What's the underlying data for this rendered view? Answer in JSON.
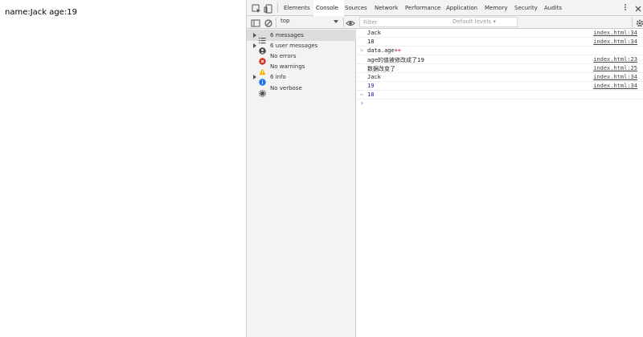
{
  "page": {
    "text": "name:Jack age:19"
  },
  "devtools": {
    "tabs": [
      {
        "label": "Elements",
        "active": false
      },
      {
        "label": "Console",
        "active": true
      },
      {
        "label": "Sources",
        "active": false
      },
      {
        "label": "Network",
        "active": false
      },
      {
        "label": "Performance",
        "active": false
      },
      {
        "label": "Application",
        "active": false
      },
      {
        "label": "Memory",
        "active": false
      },
      {
        "label": "Security",
        "active": false
      },
      {
        "label": "Audits",
        "active": false
      }
    ],
    "toolbar": {
      "context": "top",
      "filter_placeholder": "Filter",
      "levels": "Default levels ▾"
    },
    "sidebar": [
      {
        "label": "6 messages",
        "icon": "list-icon",
        "expandable": true,
        "selected": true
      },
      {
        "label": "6 user messages",
        "icon": "user-icon",
        "expandable": true,
        "selected": false
      },
      {
        "label": "No errors",
        "icon": "error-icon",
        "expandable": false,
        "selected": false
      },
      {
        "label": "No warnings",
        "icon": "warning-icon",
        "expandable": false,
        "selected": false
      },
      {
        "label": "6 info",
        "icon": "info-icon",
        "expandable": true,
        "selected": false
      },
      {
        "label": "No verbose",
        "icon": "verbose-icon",
        "expandable": false,
        "selected": false
      }
    ],
    "console": {
      "rows": [
        {
          "text": "Jack",
          "source": "index.html:34"
        },
        {
          "text": "18",
          "source": "index.html:34"
        },
        {
          "command_name": "data.age",
          "command_op": "++"
        },
        {
          "text": "age的值被修改成了19",
          "source": "index.html:23"
        },
        {
          "text": "数据改变了",
          "source": "index.html:25"
        },
        {
          "text": "Jack",
          "source": "index.html:34"
        },
        {
          "text": "19",
          "source": "index.html:34"
        },
        {
          "result": "18"
        }
      ]
    },
    "colors": {
      "accent": "#1a73e8",
      "error": "#d93025",
      "warning": "#f4b400",
      "info": "#1a73e8",
      "number": "#1a1aa6"
    }
  }
}
